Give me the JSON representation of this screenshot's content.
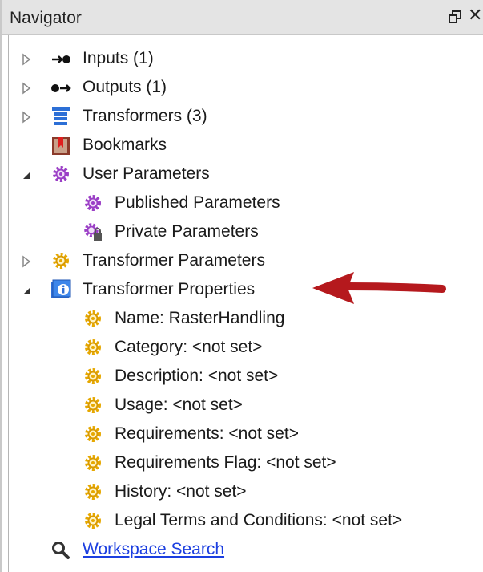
{
  "panel": {
    "title": "Navigator",
    "float_symbol": "",
    "close_symbol": "✕"
  },
  "tree": {
    "inputs": "Inputs (1)",
    "outputs": "Outputs (1)",
    "transformers": "Transformers (3)",
    "bookmarks": "Bookmarks",
    "user_parameters": "User Parameters",
    "published_parameters": "Published Parameters",
    "private_parameters": "Private Parameters",
    "transformer_parameters": "Transformer Parameters",
    "transformer_properties": "Transformer Properties",
    "props": [
      "Name: RasterHandling",
      "Category: <not set>",
      "Description: <not set>",
      "Usage: <not set>",
      "Requirements: <not set>",
      "Requirements Flag: <not set>",
      "History: <not set>",
      "Legal Terms and Conditions: <not set>"
    ],
    "workspace_search": "Workspace Search"
  },
  "icons": {
    "input": "input-port-icon",
    "output": "output-port-icon",
    "transformers": "transformers-stack-icon",
    "bookmark": "bookmark-icon",
    "gear_purple": "purple-gear-icon",
    "gear_yellow": "yellow-gear-icon",
    "info": "info-icon",
    "search": "search-icon"
  },
  "colors": {
    "purple_gear": "#9b3fc6",
    "yellow_gear": "#e6a800",
    "link": "#1c3fe0",
    "arrow": "#b5191d"
  }
}
